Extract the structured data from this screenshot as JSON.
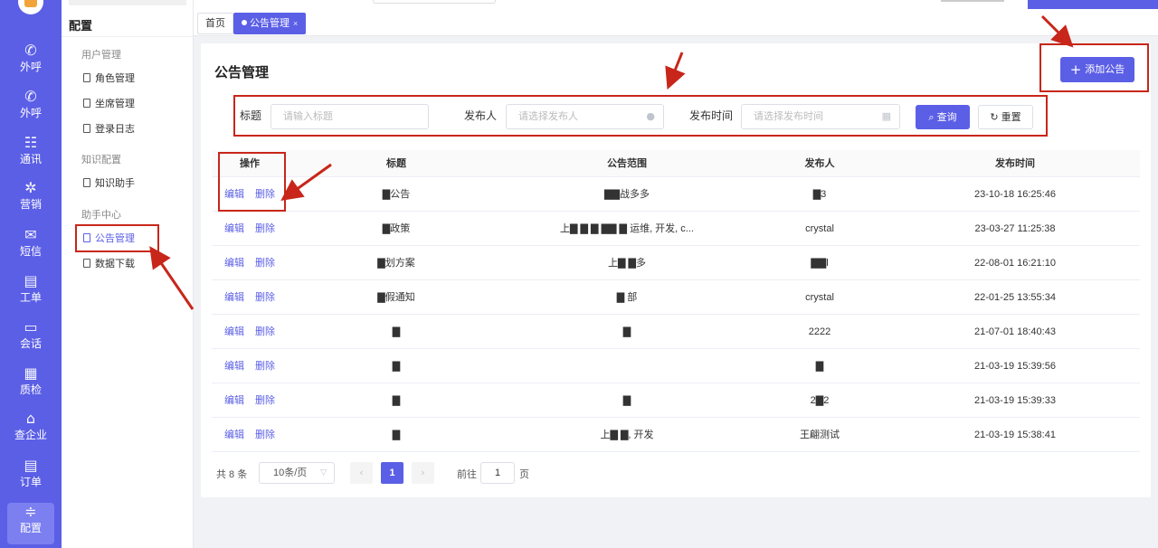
{
  "rail": {
    "items": [
      {
        "label": "外呼",
        "icon": "phone-out-icon",
        "glyph": "✆"
      },
      {
        "label": "外呼",
        "icon": "phone-call-icon",
        "glyph": "✆"
      },
      {
        "label": "通讯",
        "icon": "contacts-icon",
        "glyph": "☷"
      },
      {
        "label": "营销",
        "icon": "marketing-icon",
        "glyph": "✲"
      },
      {
        "label": "短信",
        "icon": "message-icon",
        "glyph": "✉"
      },
      {
        "label": "工单",
        "icon": "clipboard-icon",
        "glyph": "▤"
      },
      {
        "label": "会话",
        "icon": "chat-icon",
        "glyph": "▭"
      },
      {
        "label": "质检",
        "icon": "calendar-check-icon",
        "glyph": "▦"
      },
      {
        "label": "查企业",
        "icon": "building-icon",
        "glyph": "⌂"
      },
      {
        "label": "订单",
        "icon": "order-icon",
        "glyph": "▤"
      },
      {
        "label": "配置",
        "icon": "settings-sliders-icon",
        "glyph": "≑"
      }
    ]
  },
  "sidebar": {
    "title": "配置",
    "groups": [
      {
        "label": "用户管理",
        "items": [
          "角色管理",
          "坐席管理",
          "登录日志"
        ]
      },
      {
        "label": "知识配置",
        "items": [
          "知识助手"
        ]
      },
      {
        "label": "助手中心",
        "items": [
          "公告管理",
          "数据下载"
        ]
      }
    ]
  },
  "tabs": [
    {
      "label": "首页"
    },
    {
      "label": "公告管理",
      "close": "×"
    }
  ],
  "page": {
    "title": "公告管理",
    "add_button": "添加公告"
  },
  "filters": {
    "title_label": "标题",
    "title_placeholder": "请输入标题",
    "publisher_label": "发布人",
    "publisher_placeholder": "请选择发布人",
    "time_label": "发布时间",
    "time_placeholder": "请选择发布时间",
    "query_button": "查询",
    "reset_button": "重置"
  },
  "table": {
    "columns": [
      "操作",
      "标题",
      "公告范围",
      "发布人",
      "发布时间"
    ],
    "edit_label": "编辑",
    "delete_label": "删除",
    "rows": [
      {
        "title": "▇公告",
        "scope": "▇▇战多多",
        "publisher": "▇3",
        "time": "23-10-18 16:25:46"
      },
      {
        "title": "▇政策",
        "scope": "上▇ ▇ ▇ ▇▇ ▇ 运维, 开发, c...",
        "publisher": "crystal",
        "time": "23-03-27 11:25:38"
      },
      {
        "title": "▇划方案",
        "scope": "上▇ ▇多",
        "publisher": "▇▇l",
        "time": "22-08-01 16:21:10"
      },
      {
        "title": "▇假通知",
        "scope": "▇ 部",
        "publisher": "crystal",
        "time": "22-01-25 13:55:34"
      },
      {
        "title": "▇",
        "scope": "▇",
        "publisher": "2222",
        "time": "21-07-01 18:40:43"
      },
      {
        "title": "▇",
        "scope": "",
        "publisher": "▇",
        "time": "21-03-19 15:39:56"
      },
      {
        "title": "▇",
        "scope": "▇",
        "publisher": "2▇2",
        "time": "21-03-19 15:39:33"
      },
      {
        "title": "▇",
        "scope": "上▇ ▇, 开发",
        "publisher": "王翩测试",
        "time": "21-03-19 15:38:41"
      }
    ]
  },
  "pagination": {
    "total": "共 8 条",
    "page_size": "10条/页",
    "current_page": "1",
    "goto_prefix": "前往",
    "goto_value": "1",
    "goto_suffix": "页"
  },
  "colors": {
    "accent": "#5b5fe6",
    "annotation": "#c8261a"
  }
}
